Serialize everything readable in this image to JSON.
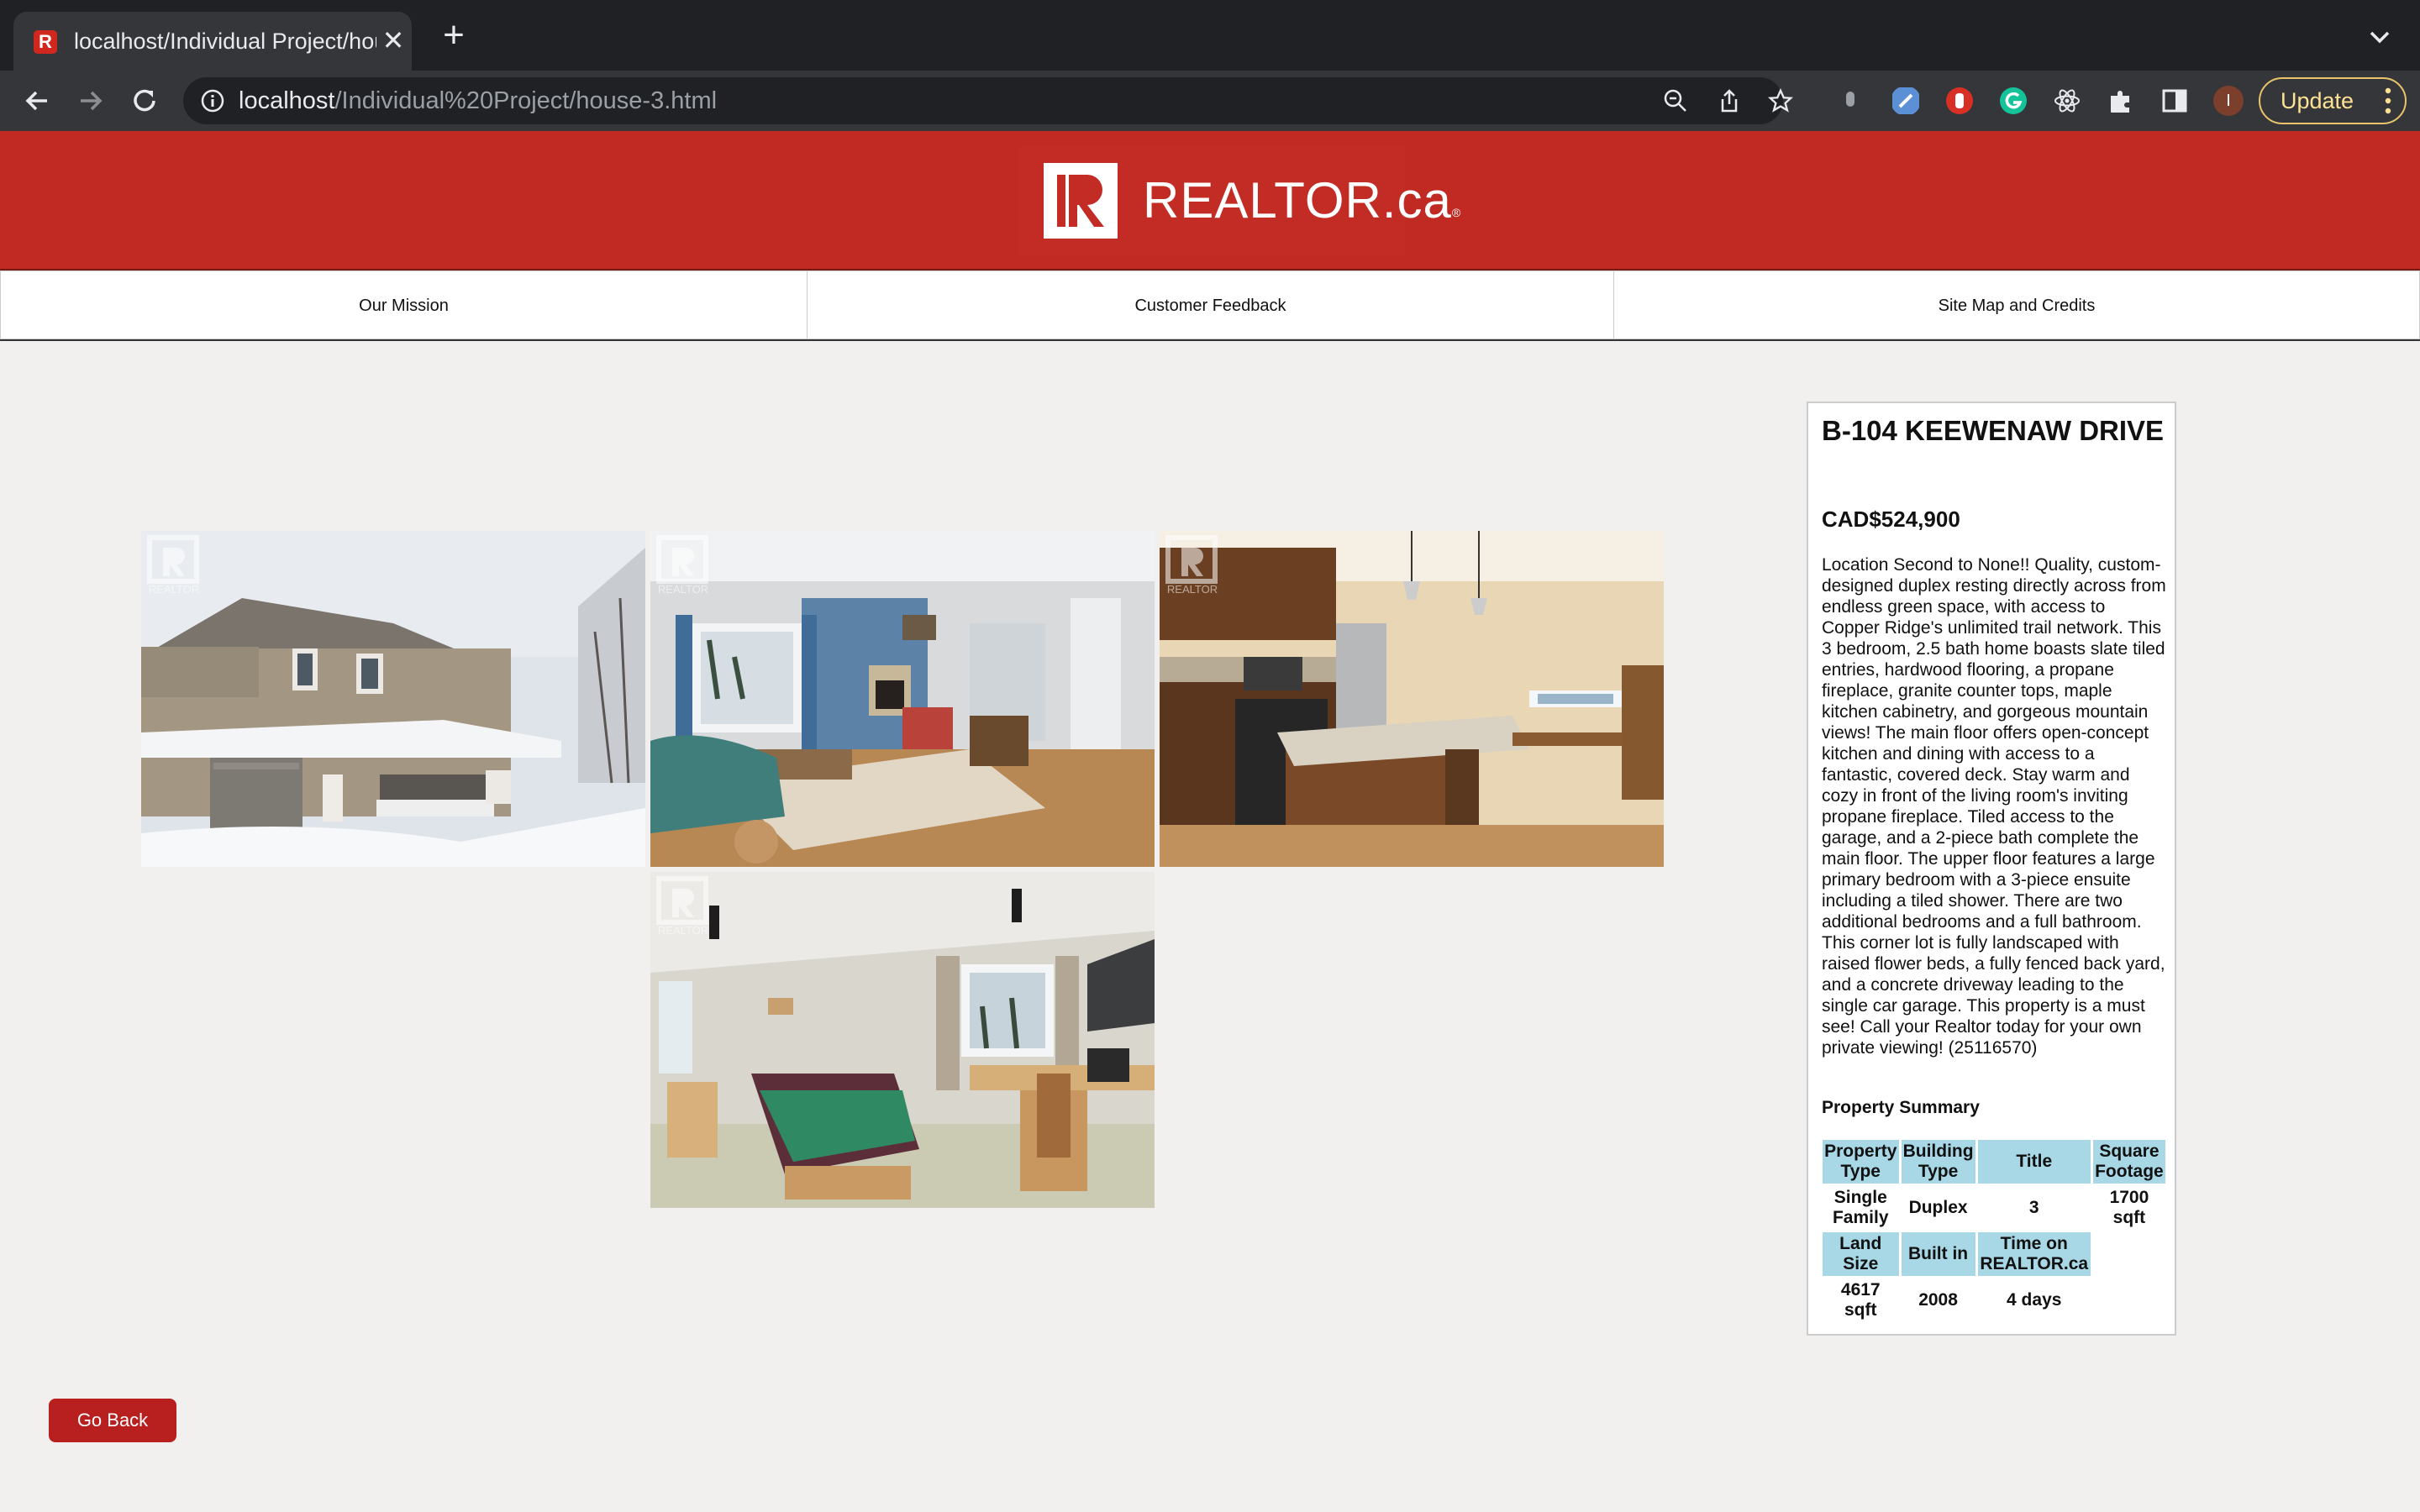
{
  "browser": {
    "tab_title": "localhost/Individual Project/hou",
    "tab_favicon_letter": "R",
    "close_glyph": "✕",
    "newtab_glyph": "+",
    "url_host": "localhost",
    "url_path": "/Individual%20Project/house-3.html",
    "update_label": "Update",
    "avatar_letter": "I"
  },
  "site": {
    "logo_text": "REALTOR.ca",
    "logo_reg": "®",
    "logo_mark": "R",
    "nav": [
      "Our Mission",
      "Customer Feedback",
      "Site Map and Credits"
    ]
  },
  "gallery": {
    "watermark_text": "REALTOR",
    "photos": [
      "exterior-photo",
      "living-room-photo",
      "kitchen-photo",
      "bedroom-photo"
    ]
  },
  "listing": {
    "address": "B-104 KEEWENAW DRIVE",
    "price": "CAD$524,900",
    "description": "Location Second to None!! Quality, custom-designed duplex resting directly across from endless green space, with access to Copper Ridge's unlimited trail network. This 3 bedroom, 2.5 bath home boasts slate tiled entries, hardwood flooring, a propane fireplace, granite counter tops, maple kitchen cabinetry, and gorgeous mountain views! The main floor offers open-concept kitchen and dining with access to a fantastic, covered deck. Stay warm and cozy in front of the living room's inviting propane fireplace. Tiled access to the garage, and a 2-piece bath complete the main floor. The upper floor features a large primary bedroom with a 3-piece ensuite including a tiled shower. There are two additional bedrooms and a full bathroom. This corner lot is fully landscaped with raised flower beds, a fully fenced back yard, and a concrete driveway leading to the single car garage. This property is a must see! Call your Realtor today for your own private viewing! (25116570)",
    "summary_title": "Property Summary",
    "summary": {
      "h1": [
        "Property Type",
        "Building Type",
        "Title",
        "Square Footage"
      ],
      "r1": [
        "Single Family",
        "Duplex",
        "3",
        "1700 sqft"
      ],
      "h2": [
        "Land Size",
        "Built in",
        "Time on REALTOR.ca"
      ],
      "r2": [
        "4617 sqft",
        "2008",
        "4 days"
      ]
    },
    "go_back": "Go Back"
  },
  "colors": {
    "brand_red": "#c02a22",
    "button_red": "#b8201f",
    "table_header": "#a8d8e6"
  }
}
